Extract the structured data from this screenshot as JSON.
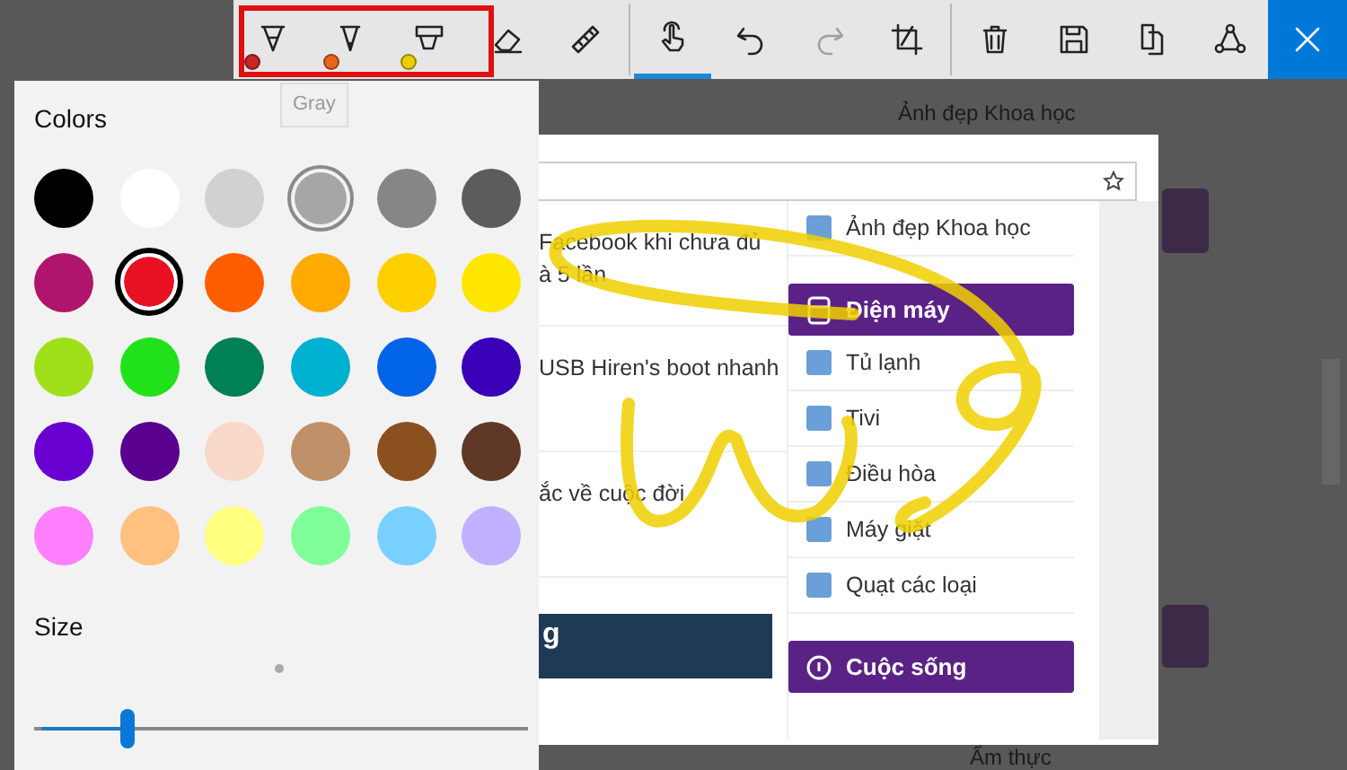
{
  "toolbar": {
    "pens": [
      {
        "kind": "ballpoint",
        "color": "#c62828"
      },
      {
        "kind": "pencil",
        "color": "#e8641e"
      },
      {
        "kind": "highlighter",
        "color": "#e8d000"
      }
    ],
    "tools": [
      {
        "kind": "eraser",
        "active": false,
        "disabled": false
      },
      {
        "kind": "ruler",
        "active": false,
        "disabled": false
      },
      {
        "kind": "touch",
        "active": true,
        "disabled": false
      },
      {
        "kind": "undo",
        "active": false,
        "disabled": false
      },
      {
        "kind": "redo",
        "active": false,
        "disabled": true
      },
      {
        "kind": "crop",
        "active": false,
        "disabled": false
      },
      {
        "kind": "delete",
        "active": false,
        "disabled": false
      },
      {
        "kind": "save",
        "active": false,
        "disabled": false
      },
      {
        "kind": "copy",
        "active": false,
        "disabled": false
      },
      {
        "kind": "share",
        "active": false,
        "disabled": false
      },
      {
        "kind": "close",
        "active": false,
        "disabled": false
      }
    ]
  },
  "tooltip": {
    "text": "Gray"
  },
  "color_panel": {
    "title": "Colors",
    "colors": [
      {
        "color": "#000000",
        "selected": false,
        "hovered": false
      },
      {
        "color": "#ffffff",
        "selected": false,
        "hovered": false
      },
      {
        "color": "#d1d1d1",
        "selected": false,
        "hovered": false
      },
      {
        "color": "#a6a6a6",
        "selected": false,
        "hovered": true
      },
      {
        "color": "#868686",
        "selected": false,
        "hovered": false
      },
      {
        "color": "#5c5c5c",
        "selected": false,
        "hovered": false
      },
      {
        "color": "#b0156e",
        "selected": false,
        "hovered": false
      },
      {
        "color": "#e81123",
        "selected": true,
        "hovered": false
      },
      {
        "color": "#ff5e00",
        "selected": false,
        "hovered": false
      },
      {
        "color": "#ffaa00",
        "selected": false,
        "hovered": false
      },
      {
        "color": "#ffd000",
        "selected": false,
        "hovered": false
      },
      {
        "color": "#ffe600",
        "selected": false,
        "hovered": false
      },
      {
        "color": "#9fe01b",
        "selected": false,
        "hovered": false
      },
      {
        "color": "#21e11a",
        "selected": false,
        "hovered": false
      },
      {
        "color": "#008055",
        "selected": false,
        "hovered": false
      },
      {
        "color": "#00b0d0",
        "selected": false,
        "hovered": false
      },
      {
        "color": "#0063e8",
        "selected": false,
        "hovered": false
      },
      {
        "color": "#3a00b8",
        "selected": false,
        "hovered": false
      },
      {
        "color": "#6800d0",
        "selected": false,
        "hovered": false
      },
      {
        "color": "#5a0090",
        "selected": false,
        "hovered": false
      },
      {
        "color": "#f8d8c8",
        "selected": false,
        "hovered": false
      },
      {
        "color": "#c09068",
        "selected": false,
        "hovered": false
      },
      {
        "color": "#8a5020",
        "selected": false,
        "hovered": false
      },
      {
        "color": "#603828",
        "selected": false,
        "hovered": false
      },
      {
        "color": "#ff80ff",
        "selected": false,
        "hovered": false
      },
      {
        "color": "#ffc080",
        "selected": false,
        "hovered": false
      },
      {
        "color": "#ffff80",
        "selected": false,
        "hovered": false
      },
      {
        "color": "#80ff98",
        "selected": false,
        "hovered": false
      },
      {
        "color": "#78d0ff",
        "selected": false,
        "hovered": false
      },
      {
        "color": "#c0b0ff",
        "selected": false,
        "hovered": false
      }
    ],
    "size": {
      "label": "Size",
      "level": 0.18
    }
  },
  "background": {
    "texts": [
      "Ảnh đẹp Khoa học",
      "Ẩm thực"
    ]
  },
  "screenshot": {
    "articles": [
      {
        "lines": [
          "Facebook khi chưa đủ",
          "à 5 lần"
        ]
      },
      {
        "lines": [
          "USB Hiren's boot nhanh"
        ]
      },
      {
        "lines": [
          "ắc về cuộc đời"
        ]
      }
    ],
    "image_caption": "g",
    "sidebar": [
      {
        "kind": "item",
        "label": "Ảnh đẹp Khoa học"
      },
      {
        "kind": "header",
        "label": "Điện máy"
      },
      {
        "kind": "item",
        "label": "Tủ lạnh"
      },
      {
        "kind": "item",
        "label": "Tivi"
      },
      {
        "kind": "item",
        "label": "Điều hòa"
      },
      {
        "kind": "item",
        "label": "Máy giặt"
      },
      {
        "kind": "item",
        "label": "Quạt các loại"
      },
      {
        "kind": "header",
        "label": "Cuộc sống"
      }
    ]
  }
}
